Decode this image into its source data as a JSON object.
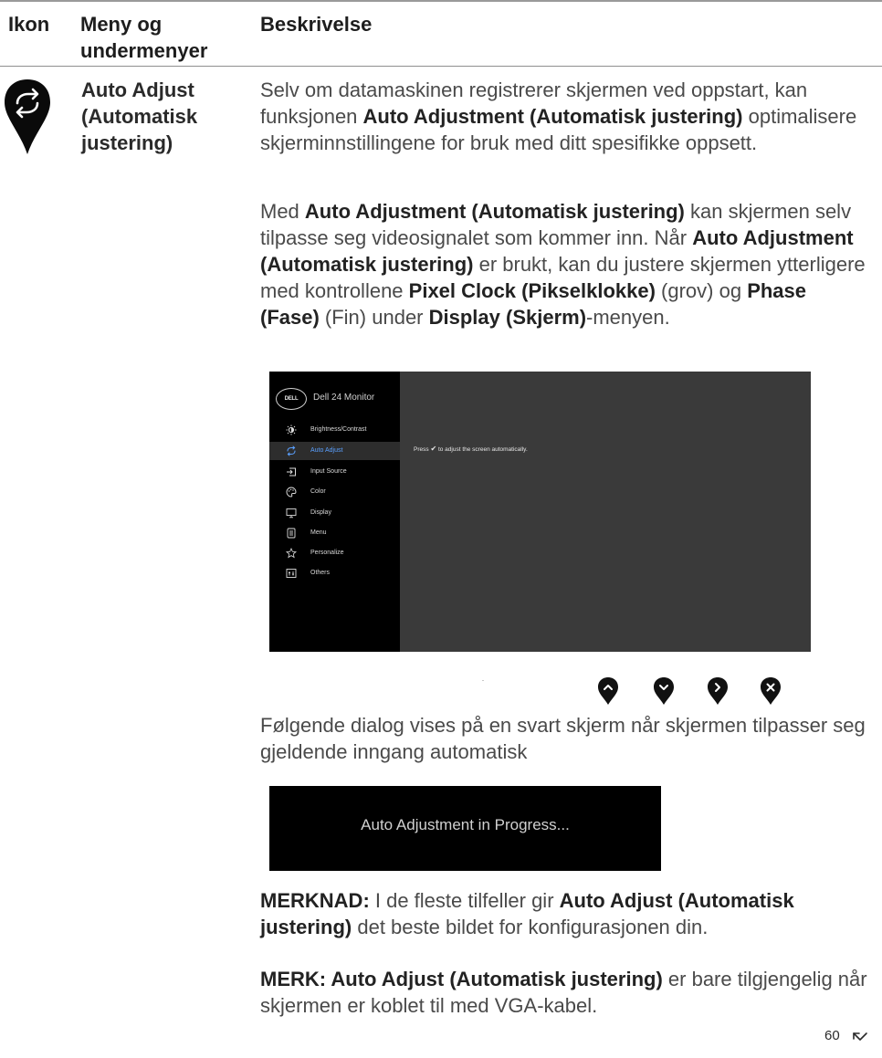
{
  "table_header": {
    "col1": "Ikon",
    "col2": "Meny og undermenyer",
    "col3": "Beskrivelse"
  },
  "row": {
    "icon": "auto-adjust-marker-icon",
    "menu_name": "Auto Adjust (Automatisk justering)"
  },
  "paragraphs": {
    "p1": {
      "t1": "Selv om datamaskinen registrerer skjermen ved oppstart, kan funksjonen ",
      "b1": "Auto Adjustment (Automatisk justering)",
      "t2": " optimalisere skjerminnstillingene for bruk med ditt spesifikke oppsett."
    },
    "p2": {
      "t1": "Med ",
      "b1": "Auto Adjustment (Automatisk justering)",
      "t2": " kan skjermen selv tilpasse seg videosignalet som kommer inn. Når ",
      "b2": "Auto Adjustment (Automatisk justering)",
      "t3": " er brukt, kan du justere skjermen ytterligere med kontrollene ",
      "b3": "Pixel Clock (Pikselklokke)",
      "t4": " (grov) og ",
      "b4": "Phase (Fase)",
      "t5": " (Fin) under ",
      "b5": "Display (Skjerm)",
      "t6": "-menyen."
    },
    "p3": "Følgende dialog vises på en svart skjerm når skjermen tilpasser seg gjeldende inngang automatisk",
    "p4": {
      "b1": "MERKNAD:",
      "t1": " I de fleste tilfeller gir ",
      "b2": "Auto Adjust (Automatisk justering)",
      "t2": " det beste bildet for konfigurasjonen din."
    },
    "p5": {
      "b1": "MERK: Auto Adjust (Automatisk justering)",
      "t1": " er bare tilgjengelig når skjermen er koblet til med VGA-kabel."
    }
  },
  "osd": {
    "logo": "DELL",
    "title": "Dell 24 Monitor",
    "items": [
      {
        "label": "Brightness/Contrast",
        "icon": "brightness-icon"
      },
      {
        "label": "Auto Adjust",
        "icon": "auto-adjust-icon"
      },
      {
        "label": "Input Source",
        "icon": "input-source-icon"
      },
      {
        "label": "Color",
        "icon": "color-palette-icon"
      },
      {
        "label": "Display",
        "icon": "display-icon"
      },
      {
        "label": "Menu",
        "icon": "menu-icon"
      },
      {
        "label": "Personalize",
        "icon": "star-icon"
      },
      {
        "label": "Others",
        "icon": "others-icon"
      }
    ],
    "active_index": 1,
    "message_pre": "Press",
    "message_check": "✔",
    "message_post": "to adjust the screen automatically.",
    "active_color": "#5aa0ff"
  },
  "nav_buttons": [
    "up-icon",
    "down-icon",
    "right-icon",
    "close-icon"
  ],
  "dialog": {
    "text": "Auto Adjustment in Progress..."
  },
  "page": {
    "number": "60"
  }
}
